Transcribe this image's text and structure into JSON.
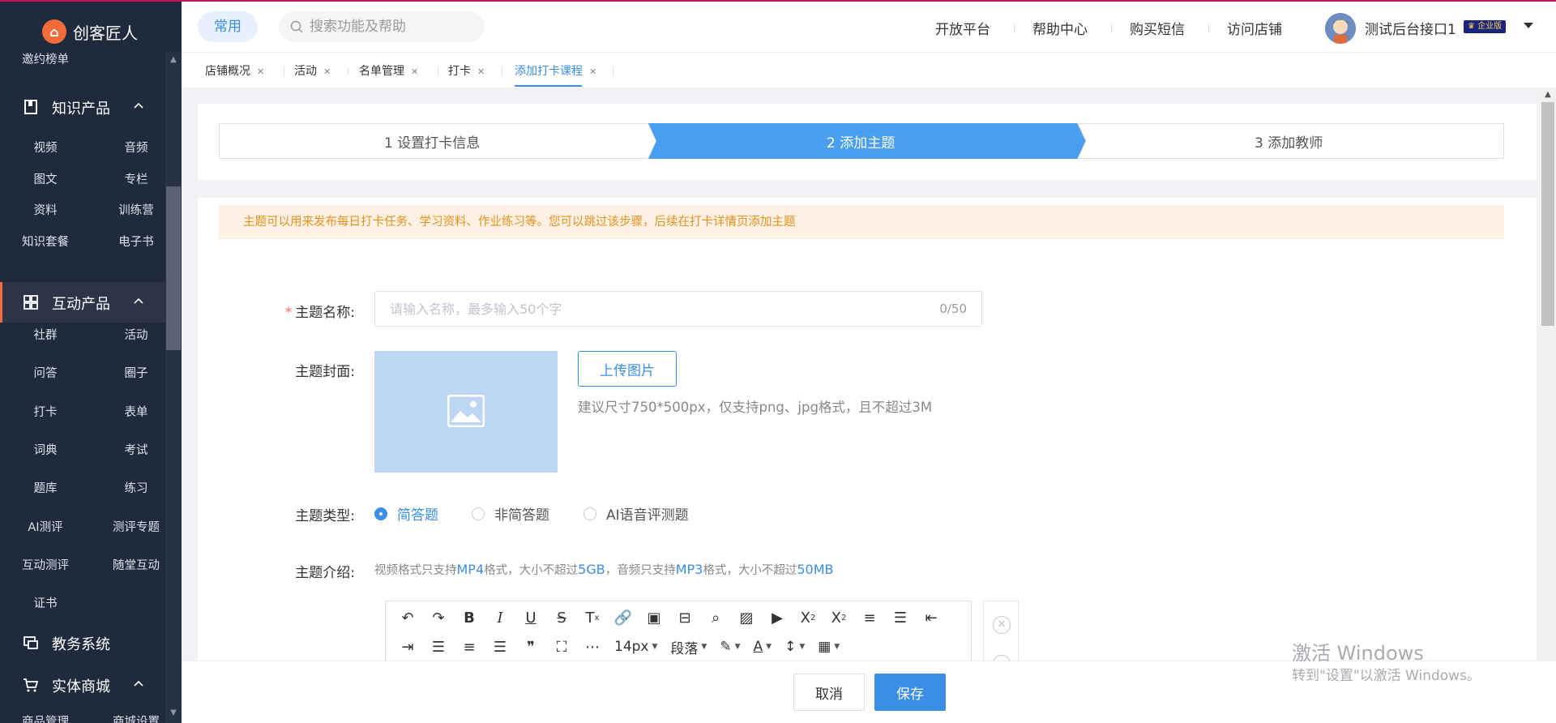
{
  "brand": {
    "name": "创客匠人",
    "logo_glyph": "⌂"
  },
  "sidebar": {
    "top_item": "邀约榜单",
    "groups": [
      {
        "label": "知识产品",
        "icon": "book-icon",
        "items": [
          "视频",
          "音频",
          "图文",
          "专栏",
          "资料",
          "训练营",
          "知识套餐",
          "电子书"
        ]
      },
      {
        "label": "互动产品",
        "icon": "grid-icon",
        "items": [
          "社群",
          "活动",
          "问答",
          "圈子",
          "打卡",
          "表单",
          "词典",
          "考试",
          "题库",
          "练习",
          "AI测评",
          "测评专题",
          "互动测评",
          "随堂互动",
          "证书"
        ]
      },
      {
        "label": "教务系统",
        "icon": "monitor-icon",
        "items": []
      },
      {
        "label": "实体商城",
        "icon": "cart-icon",
        "items": [
          "商品管理",
          "商城设置"
        ]
      }
    ]
  },
  "header": {
    "pill": "常用",
    "search_placeholder": "搜索功能及帮助",
    "links": [
      "开放平台",
      "帮助中心",
      "购买短信",
      "访问店铺"
    ],
    "user_name": "测试后台接口1",
    "badge": "企业版"
  },
  "tabs": [
    {
      "label": "店铺概况",
      "active": false
    },
    {
      "label": "活动",
      "active": false
    },
    {
      "label": "名单管理",
      "active": false
    },
    {
      "label": "打卡",
      "active": false
    },
    {
      "label": "添加打卡课程",
      "active": true
    }
  ],
  "steps": [
    "1 设置打卡信息",
    "2 添加主题",
    "3 添加教师"
  ],
  "active_step": 2,
  "notice": "主题可以用来发布每日打卡任务、学习资料、作业练习等。您可以跳过该步骤，后续在打卡详情页添加主题",
  "form": {
    "name_label": "主题名称:",
    "name_placeholder": "请输入名称，最多输入50个字",
    "name_counter": "0/50",
    "cover_label": "主题封面:",
    "upload_label": "上传图片",
    "cover_hint": "建议尺寸750*500px，仅支持png、jpg格式，且不超过3M",
    "type_label": "主题类型:",
    "types": [
      {
        "label": "简答题",
        "checked": true
      },
      {
        "label": "非简答题",
        "checked": false
      },
      {
        "label": "AI语音评测题",
        "checked": false
      }
    ],
    "intro_label": "主题介绍:",
    "intro_hint": {
      "t1": "视频格式只支持",
      "mp4": "MP4",
      "t2": "格式，大小不超过",
      "size1": "5GB",
      "t3": "，音频只支持",
      "mp3": "MP3",
      "t4": "格式，大小不超过",
      "size2": "50MB"
    },
    "editor": {
      "font_size": "14px",
      "paragraph": "段落"
    }
  },
  "footer": {
    "cancel": "取消",
    "save": "保存"
  },
  "watermark": {
    "line1": "激活 Windows",
    "line2": "转到\"设置\"以激活 Windows。"
  },
  "colors": {
    "accent": "#3a8ee6",
    "brand": "#f26b3a",
    "sidebar_bg": "#1f2a3c",
    "notice_bg": "#fdf1e4",
    "notice_text": "#e8901c"
  }
}
